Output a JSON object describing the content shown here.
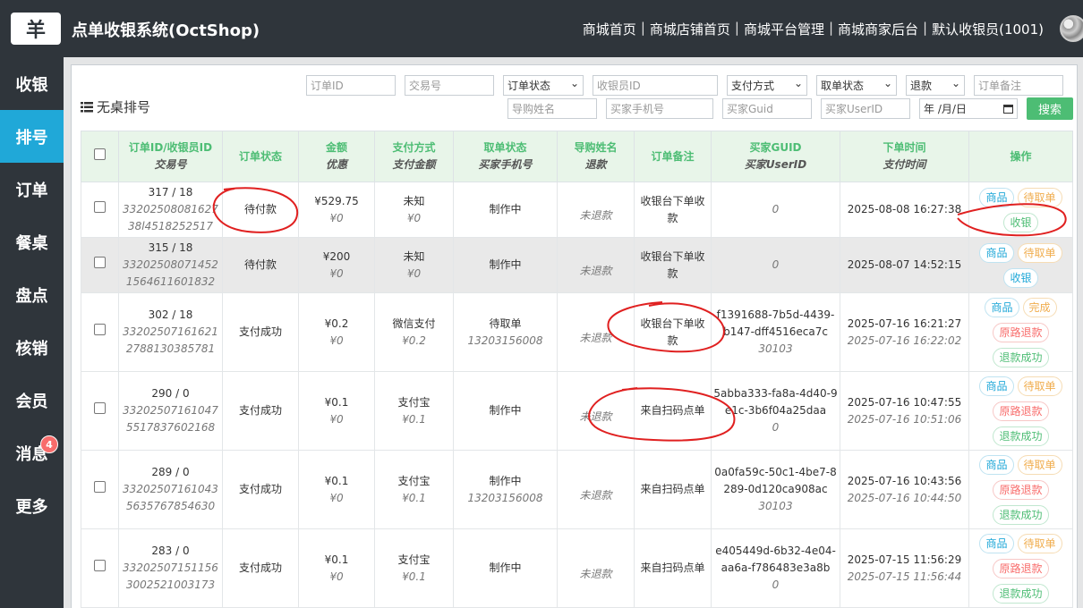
{
  "app": {
    "logo_glyph": "羊",
    "title": "点单收银系统(OctShop)"
  },
  "top_nav": [
    "商城首页",
    "商城店铺首页",
    "商城平台管理",
    "商城商家后台",
    "默认收银员(1001)"
  ],
  "sidebar": {
    "items": [
      {
        "label": "收银"
      },
      {
        "label": "排号",
        "active": true
      },
      {
        "label": "订单"
      },
      {
        "label": "餐桌"
      },
      {
        "label": "盘点"
      },
      {
        "label": "核销"
      },
      {
        "label": "会员"
      },
      {
        "label": "消息",
        "badge": "4"
      },
      {
        "label": "更多"
      }
    ]
  },
  "card": {
    "title": "无桌排号"
  },
  "filters": {
    "order_id": "订单ID",
    "trade_no": "交易号",
    "order_status": "订单状态",
    "cashier_id": "收银员ID",
    "pay_method": "支付方式",
    "pickup_status": "取单状态",
    "refund": "退款",
    "remark": "订单备注",
    "guide_name": "导购姓名",
    "buyer_phone": "买家手机号",
    "buyer_guid": "买家Guid",
    "buyer_userid": "买家UserID",
    "date": "年 /月/日",
    "search": "搜索"
  },
  "table": {
    "headers": [
      {
        "main": "订单ID/收银员ID",
        "sub": "交易号"
      },
      {
        "main": "订单状态",
        "sub": ""
      },
      {
        "main": "金额",
        "sub": "优惠"
      },
      {
        "main": "支付方式",
        "sub": "支付金额"
      },
      {
        "main": "取单状态",
        "sub": "买家手机号"
      },
      {
        "main": "导购姓名",
        "sub": "退款"
      },
      {
        "main": "订单备注",
        "sub": ""
      },
      {
        "main": "买家GUID",
        "sub": "买家UserID"
      },
      {
        "main": "下单时间",
        "sub": "支付时间"
      },
      {
        "main": "操作",
        "sub": ""
      }
    ],
    "rows": [
      {
        "id": "317 / 18",
        "trade": "3320250808162738l4518252517",
        "status": "待付款",
        "amount": "¥529.75",
        "discount": "¥0",
        "pay": "未知",
        "pay_amt": "¥0",
        "pickup": "制作中",
        "phone": "",
        "guide": "",
        "refund": "未退款",
        "remark": "收银台下单收款",
        "guid": "",
        "userid": "0",
        "order_time": "2025-08-08 16:27:38",
        "pay_time": "",
        "highlight": false,
        "ops": [
          {
            "label": "商品",
            "style": "info"
          },
          {
            "label": "待取单",
            "style": "warn"
          },
          {
            "label": "收银",
            "style": "success"
          }
        ]
      },
      {
        "id": "315 / 18",
        "trade": "332025080714521564611601832",
        "status": "待付款",
        "amount": "¥200",
        "discount": "¥0",
        "pay": "未知",
        "pay_amt": "¥0",
        "pickup": "制作中",
        "phone": "",
        "guide": "",
        "refund": "未退款",
        "remark": "收银台下单收款",
        "guid": "",
        "userid": "0",
        "order_time": "2025-08-07 14:52:15",
        "pay_time": "",
        "highlight": true,
        "ops": [
          {
            "label": "商品",
            "style": "info"
          },
          {
            "label": "待取单",
            "style": "warn"
          },
          {
            "label": "收银",
            "style": "info"
          }
        ]
      },
      {
        "id": "302 / 18",
        "trade": "332025071616212788130385781",
        "status": "支付成功",
        "amount": "¥0.2",
        "discount": "¥0",
        "pay": "微信支付",
        "pay_amt": "¥0.2",
        "pickup": "待取单",
        "phone": "13203156008",
        "guide": "",
        "refund": "未退款",
        "remark": "收银台下单收款",
        "guid": "f1391688-7b5d-4439-b147-dff4516eca7c",
        "userid": "30103",
        "order_time": "2025-07-16 16:21:27",
        "pay_time": "2025-07-16 16:22:02",
        "highlight": false,
        "ops": [
          {
            "label": "商品",
            "style": "info"
          },
          {
            "label": "完成",
            "style": "warn"
          },
          {
            "label": "原路退款",
            "style": "danger"
          },
          {
            "label": "退款成功",
            "style": "success"
          }
        ]
      },
      {
        "id": "290 / 0",
        "trade": "332025071610475517837602168",
        "status": "支付成功",
        "amount": "¥0.1",
        "discount": "¥0",
        "pay": "支付宝",
        "pay_amt": "¥0.1",
        "pickup": "制作中",
        "phone": "",
        "guide": "",
        "refund": "未退款",
        "remark": "来自扫码点单",
        "guid": "5abba333-fa8a-4d40-9e1c-3b6f04a25daa",
        "userid": "0",
        "order_time": "2025-07-16 10:47:55",
        "pay_time": "2025-07-16 10:51:06",
        "highlight": false,
        "ops": [
          {
            "label": "商品",
            "style": "info"
          },
          {
            "label": "待取单",
            "style": "warn"
          },
          {
            "label": "原路退款",
            "style": "danger"
          },
          {
            "label": "退款成功",
            "style": "success"
          }
        ]
      },
      {
        "id": "289 / 0",
        "trade": "332025071610435635767854630",
        "status": "支付成功",
        "amount": "¥0.1",
        "discount": "¥0",
        "pay": "支付宝",
        "pay_amt": "¥0.1",
        "pickup": "制作中",
        "phone": "13203156008",
        "guide": "",
        "refund": "未退款",
        "remark": "来自扫码点单",
        "guid": "0a0fa59c-50c1-4be7-8289-0d120ca908ac",
        "userid": "30103",
        "order_time": "2025-07-16 10:43:56",
        "pay_time": "2025-07-16 10:44:50",
        "highlight": false,
        "ops": [
          {
            "label": "商品",
            "style": "info"
          },
          {
            "label": "待取单",
            "style": "warn"
          },
          {
            "label": "原路退款",
            "style": "danger"
          },
          {
            "label": "退款成功",
            "style": "success"
          }
        ]
      },
      {
        "id": "283 / 0",
        "trade": "332025071511563002521003173",
        "status": "支付成功",
        "amount": "¥0.1",
        "discount": "¥0",
        "pay": "支付宝",
        "pay_amt": "¥0.1",
        "pickup": "制作中",
        "phone": "",
        "guide": "",
        "refund": "未退款",
        "remark": "来自扫码点单",
        "guid": "e405449d-6b32-4e04-aa6a-f786483e3a8b",
        "userid": "0",
        "order_time": "2025-07-15 11:56:29",
        "pay_time": "2025-07-15 11:56:44",
        "highlight": false,
        "ops": [
          {
            "label": "商品",
            "style": "info"
          },
          {
            "label": "待取单",
            "style": "warn"
          },
          {
            "label": "原路退款",
            "style": "danger"
          },
          {
            "label": "退款成功",
            "style": "success"
          }
        ]
      }
    ]
  },
  "colors": {
    "accent": "#20a8d8",
    "success": "#4dbd74",
    "warning": "#f0ad4e",
    "danger": "#f86c6b",
    "annotation": "#e02020"
  }
}
